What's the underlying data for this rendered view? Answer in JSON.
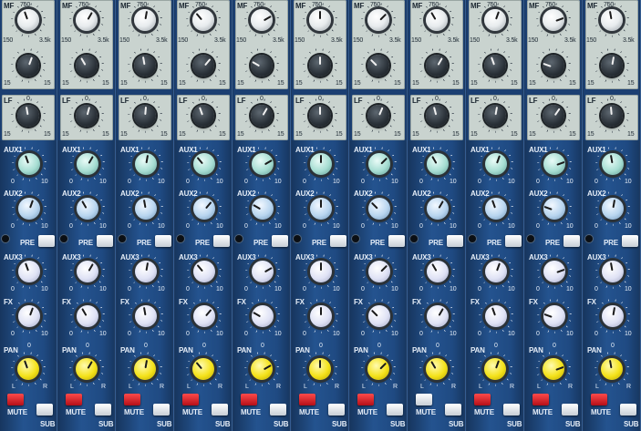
{
  "labels": {
    "mf": "MF",
    "mf_freq_top": "750",
    "mf_freq_low": "150",
    "mf_freq_high": "3.5k",
    "lf": "LF",
    "aux1": "AUX1",
    "aux2": "AUX2",
    "aux3": "AUX3",
    "fx": "FX",
    "pan": "PAN",
    "pre": "PRE",
    "mute": "MUTE",
    "sub": "SUB",
    "scale_min": "0",
    "scale_max": "10",
    "gain_min": "15",
    "gain_max": "15",
    "gain_center": "0",
    "pan_left": "L",
    "pan_right": "R"
  },
  "mixer": {
    "channel_count": 11,
    "pre_engaged": [
      false,
      false,
      false,
      false,
      false,
      false,
      false,
      false,
      false,
      false,
      false
    ],
    "mute_engaged": [
      true,
      true,
      true,
      true,
      true,
      true,
      true,
      false,
      true,
      true,
      true
    ]
  },
  "colors": {
    "panel_blue": "#1f4a82",
    "eq_panel": "#c9d3cf",
    "aux1_knob": "#a6ddd2",
    "aux2_knob": "#b8d5ef",
    "pan_knob": "#f4e21a",
    "mute_button": "#d81e28"
  },
  "icons": {
    "jack": "insert-jack-icon"
  }
}
